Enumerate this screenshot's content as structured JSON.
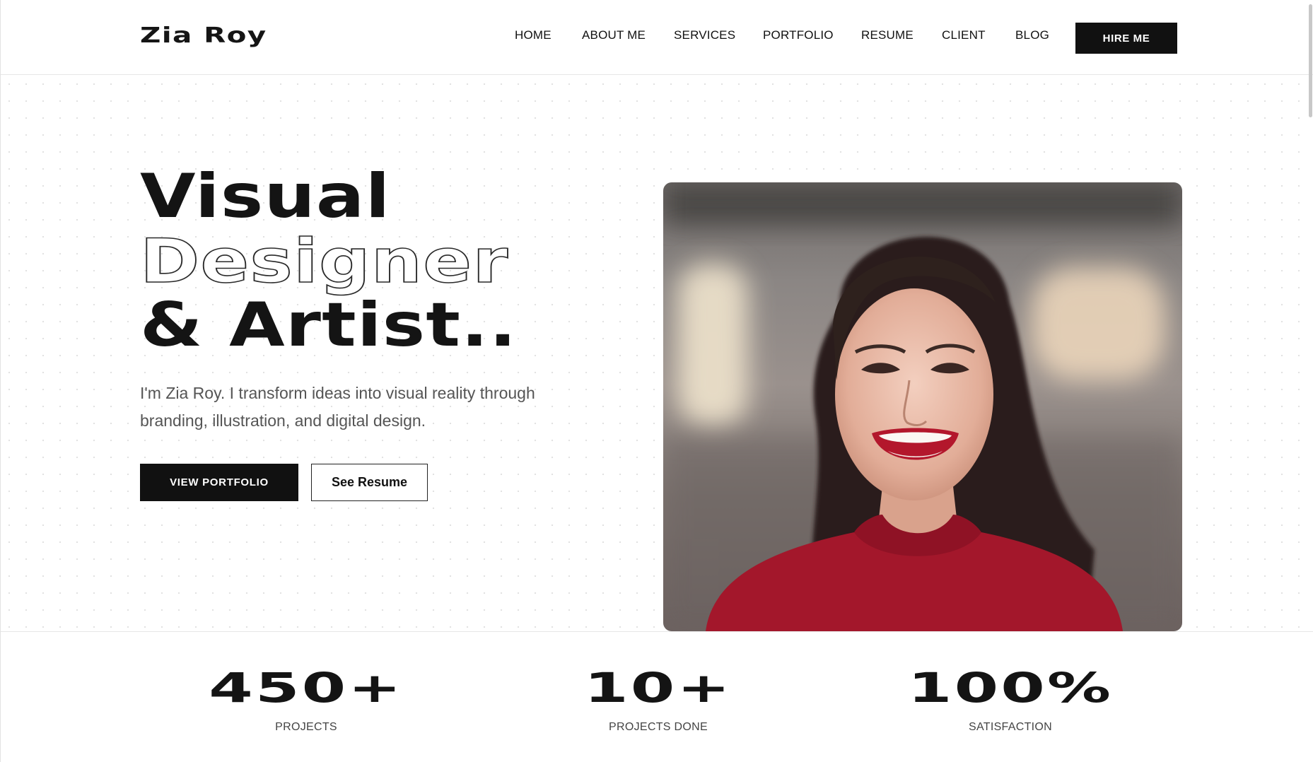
{
  "brand": {
    "name": "Zia Roy"
  },
  "nav": {
    "items": [
      "HOME",
      "ABOUT ME",
      "SERVICES",
      "PORTFOLIO",
      "RESUME",
      "CLIENT",
      "BLOG"
    ],
    "cta": "HIRE ME"
  },
  "hero": {
    "title_line1": "Visual",
    "title_line2": "Designer",
    "title_line3": "& Artist..",
    "intro_line1": "I'm Zia Roy. I transform ideas into visual reality through",
    "intro_line2": "branding, illustration, and digital design.",
    "primary_button": "VIEW PORTFOLIO",
    "secondary_button": "See Resume"
  },
  "stats": [
    {
      "value": "450+",
      "label": "PROJECTS"
    },
    {
      "value": "10+",
      "label": "PROJECTS DONE"
    },
    {
      "value": "100%",
      "label": "SATISFACTION"
    }
  ],
  "colors": {
    "text": "#111111",
    "button_bg": "#111111",
    "button_text": "#ffffff",
    "intro_text": "#555555",
    "sweater": "#a3172b"
  }
}
